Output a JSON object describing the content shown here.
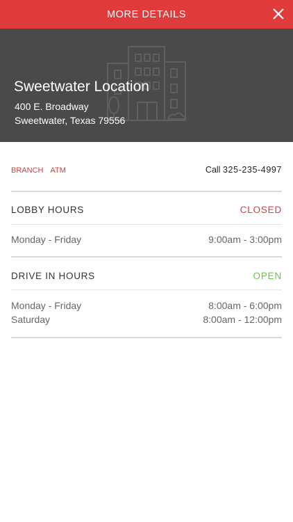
{
  "header": {
    "title": "MORE DETAILS",
    "close_icon": "close-icon",
    "bg_color": "#e03a3a"
  },
  "location": {
    "name": "Sweetwater Location",
    "address_line1": "400 E. Broadway",
    "address_line2": "Sweetwater, Texas 79556",
    "hero_icon": "building-icon"
  },
  "services": [
    "BRANCH",
    "ATM"
  ],
  "call": {
    "label": "Call",
    "phone": "325-235-4997"
  },
  "lobby": {
    "title": "LOBBY HOURS",
    "status": "CLOSED",
    "status_color": "#e03a3a",
    "rows": [
      {
        "days": "Monday - Friday",
        "hours": "9:00am - 3:00pm"
      }
    ]
  },
  "drive_in": {
    "title": "DRIVE IN HOURS",
    "status": "OPEN",
    "status_color": "#6cc04a",
    "rows": [
      {
        "days": "Monday - Friday",
        "hours": "8:00am - 6:00pm"
      },
      {
        "days": "Saturday",
        "hours": "8:00am - 12:00pm"
      }
    ]
  }
}
